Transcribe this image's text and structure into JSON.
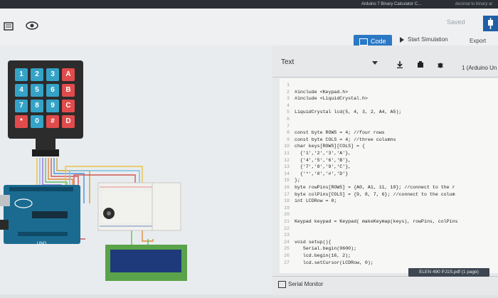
{
  "browser": {
    "tabs": [
      "Arduino 7 Binary Calculator C...",
      "decimal to binary ar"
    ]
  },
  "toolbar": {
    "saved": "Saved",
    "code_label": "Code",
    "start_simulation_label": "Start Simulation",
    "export_label": "Export"
  },
  "code_panel": {
    "mode": "Text",
    "device": "1 (Arduino Un",
    "lines": [
      {
        "n": "1",
        "t": ""
      },
      {
        "n": "2",
        "t": "#include <Keypad.h>"
      },
      {
        "n": "3",
        "t": "#include <LiquidCrystal.h>"
      },
      {
        "n": "4",
        "t": ""
      },
      {
        "n": "5",
        "t": "LiquidCrystal lcd(5, 4, 3, 2, A4, A5);"
      },
      {
        "n": "6",
        "t": ""
      },
      {
        "n": "7",
        "t": ""
      },
      {
        "n": "8",
        "t": "const byte ROWS = 4; //four rows"
      },
      {
        "n": "9",
        "t": "const byte COLS = 4; //three columns"
      },
      {
        "n": "10",
        "t": "char keys[ROWS][COLS] = {"
      },
      {
        "n": "11",
        "t": "  {'1','2','3','A'},"
      },
      {
        "n": "12",
        "t": "  {'4','5','6','B'},"
      },
      {
        "n": "13",
        "t": "  {'7','8','9','C'},"
      },
      {
        "n": "14",
        "t": "  {'*','0','#','D'}"
      },
      {
        "n": "15",
        "t": "};"
      },
      {
        "n": "16",
        "t": "byte rowPins[ROWS] = {A0, A1, 11, 10}; //connect to the r"
      },
      {
        "n": "17",
        "t": "byte colPins[COLS] = {9, 8, 7, 6}; //connect to the colum"
      },
      {
        "n": "18",
        "t": "int LCDRow = 0;"
      },
      {
        "n": "19",
        "t": ""
      },
      {
        "n": "20",
        "t": ""
      },
      {
        "n": "21",
        "t": "Keypad keypad = Keypad( makeKeymap(keys), rowPins, colPins"
      },
      {
        "n": "22",
        "t": ""
      },
      {
        "n": "23",
        "t": ""
      },
      {
        "n": "24",
        "t": "void setup(){"
      },
      {
        "n": "25",
        "t": "   Serial.begin(9600);"
      },
      {
        "n": "26",
        "t": "   lcd.begin(16, 2);"
      },
      {
        "n": "27",
        "t": "   lcd.setCursor(LCDRow, 0);"
      }
    ],
    "serial_monitor": "Serial Monitor"
  },
  "keypad": {
    "keys": [
      "1",
      "2",
      "3",
      "A",
      "4",
      "5",
      "6",
      "B",
      "7",
      "8",
      "9",
      "C",
      "*",
      "0",
      "#",
      "D"
    ]
  },
  "arduino": {
    "logo": "UNO"
  },
  "tooltip": "ELEN 490 PJ1S.pdf (1 page)",
  "colors": {
    "accent": "#2b78c4",
    "key_number": "#35a3c7",
    "key_letter": "#e14b4b",
    "keypad_body": "#2c2c2c",
    "arduino_board": "#1b6b91",
    "lcd_screen": "#1e3a7a"
  }
}
